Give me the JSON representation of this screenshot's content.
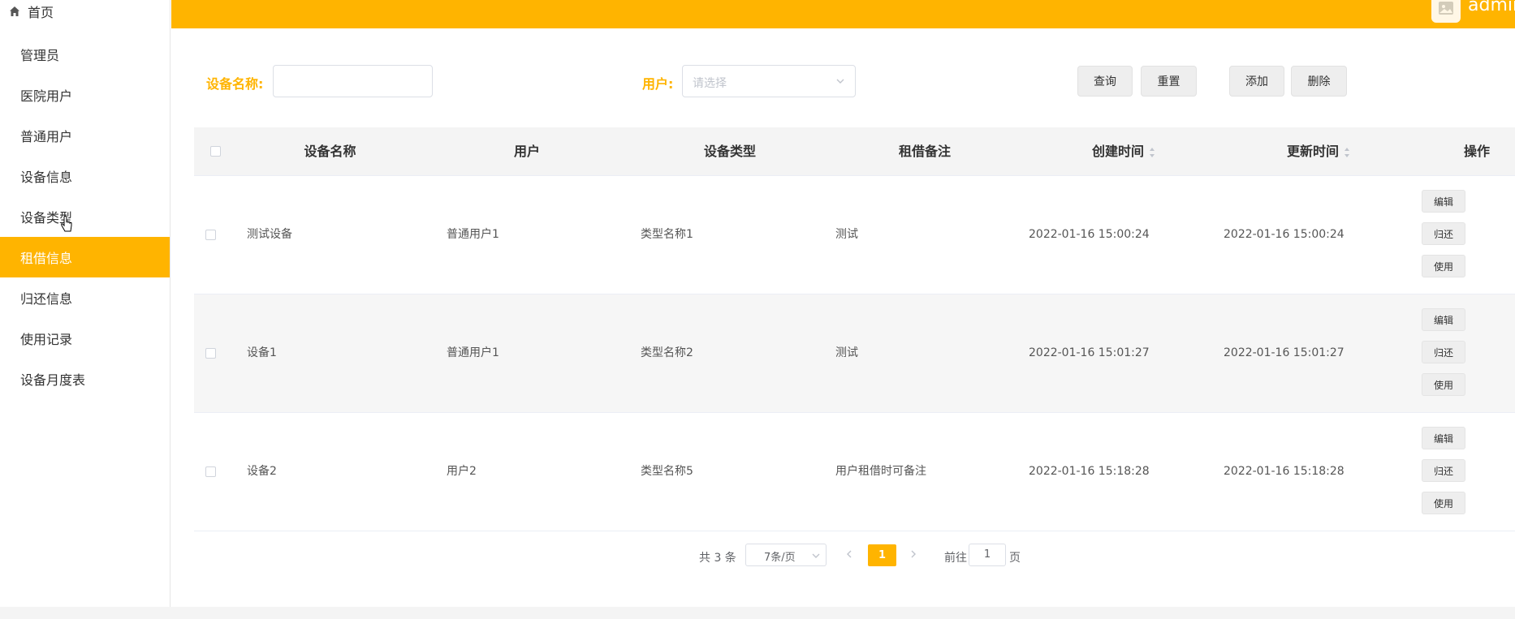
{
  "sidebar": {
    "home_label": "首页",
    "items": [
      {
        "label": "管理员"
      },
      {
        "label": "医院用户"
      },
      {
        "label": "普通用户"
      },
      {
        "label": "设备信息"
      },
      {
        "label": "设备类型"
      },
      {
        "label": "租借信息"
      },
      {
        "label": "归还信息"
      },
      {
        "label": "使用记录"
      },
      {
        "label": "设备月度表"
      }
    ],
    "active_index": 5
  },
  "header": {
    "username": "admin"
  },
  "filters": {
    "device_name_label": "设备名称:",
    "device_name_value": "",
    "user_label": "用户:",
    "user_placeholder": "请选择"
  },
  "toolbar": {
    "query_label": "查询",
    "reset_label": "重置",
    "add_label": "添加",
    "delete_label": "删除"
  },
  "table": {
    "columns": [
      "设备名称",
      "用户",
      "设备类型",
      "租借备注",
      "创建时间",
      "更新时间",
      "操作"
    ],
    "rows": [
      {
        "device": "测试设备",
        "user": "普通用户1",
        "type": "类型名称1",
        "remark": "测试",
        "created": "2022-01-16 15:00:24",
        "updated": "2022-01-16 15:00:24"
      },
      {
        "device": "设备1",
        "user": "普通用户1",
        "type": "类型名称2",
        "remark": "测试",
        "created": "2022-01-16 15:01:27",
        "updated": "2022-01-16 15:01:27"
      },
      {
        "device": "设备2",
        "user": "用户2",
        "type": "类型名称5",
        "remark": "用户租借时可备注",
        "created": "2022-01-16 15:18:28",
        "updated": "2022-01-16 15:18:28"
      }
    ],
    "actions": {
      "edit": "编辑",
      "return": "归还",
      "use": "使用"
    }
  },
  "pagination": {
    "total_text": "共 3 条",
    "page_size": "7条/页",
    "current_page": "1",
    "goto_prefix": "前往",
    "goto_value": "1",
    "goto_suffix": "页"
  },
  "colors": {
    "accent": "#ffb400"
  },
  "icons": [
    "home-icon",
    "cursor-icon",
    "avatar-icon",
    "chevron-down-icon",
    "sort-icon",
    "chevron-left-icon",
    "chevron-right-icon"
  ]
}
